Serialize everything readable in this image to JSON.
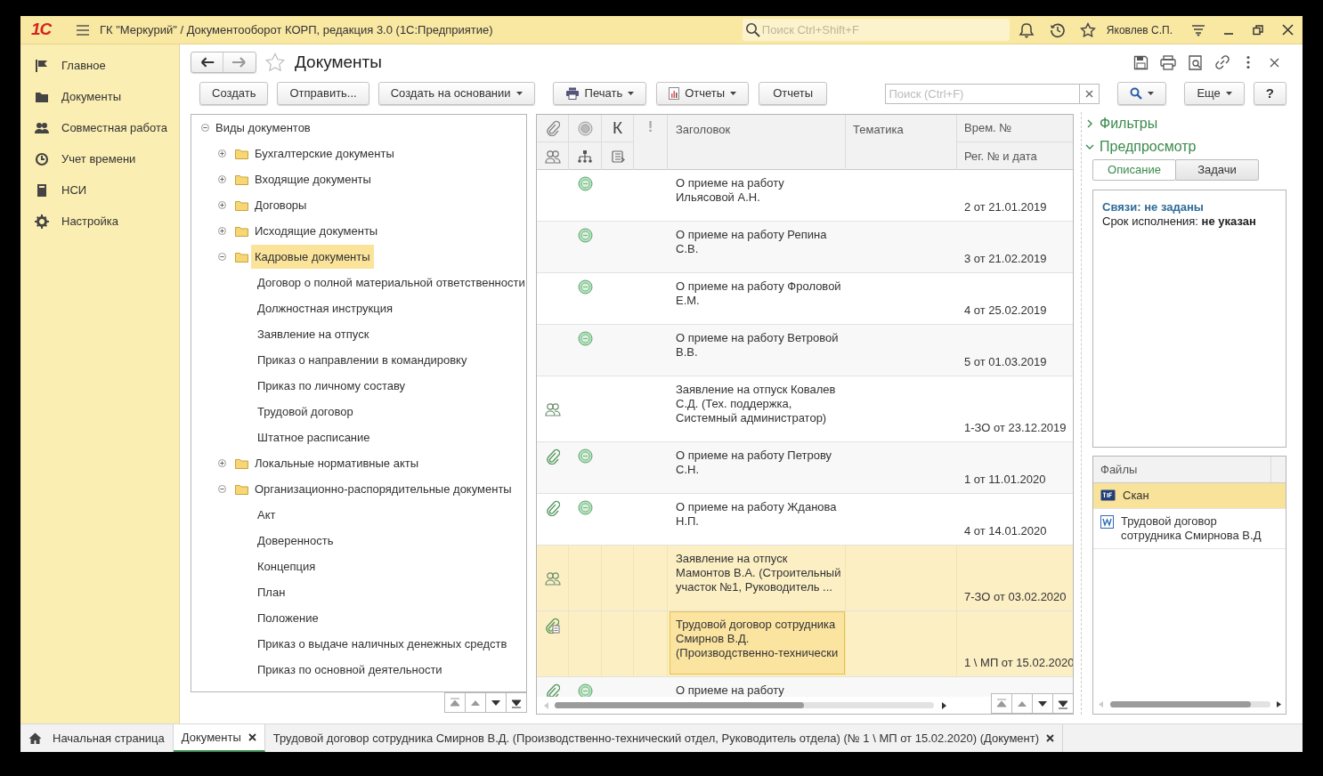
{
  "title_bar": {
    "logo": "1С",
    "title": "ГК \"Меркурий\" / Документооборот КОРП, редакция 3.0  (1С:Предприятие)",
    "search": {
      "placeholder": "Поиск Ctrl+Shift+F"
    },
    "user": "Яковлев С.П."
  },
  "sidebar": {
    "items": [
      {
        "label": "Главное"
      },
      {
        "label": "Документы"
      },
      {
        "label": "Совместная работа"
      },
      {
        "label": "Учет времени"
      },
      {
        "label": "НСИ"
      },
      {
        "label": "Настройка"
      }
    ]
  },
  "form": {
    "title": "Документы",
    "toolbar": [
      {
        "label": "Создать",
        "kind": "plain"
      },
      {
        "label": "Отправить...",
        "kind": "plain"
      },
      {
        "label": "Создать на основании",
        "kind": "dropdown"
      },
      {
        "label": "Печать",
        "kind": "print"
      },
      {
        "label": "Отчеты",
        "kind": "report"
      },
      {
        "label": "Отчеты",
        "kind": "plain"
      }
    ],
    "search": {
      "placeholder": "Поиск (Ctrl+F)"
    },
    "more_button": "Еще",
    "help_button": "?"
  },
  "tree": {
    "items": [
      {
        "label": "Виды документов",
        "kind": "root",
        "expanded": true,
        "selected": false,
        "children": [
          {
            "label": "Бухгалтерские документы",
            "kind": "folder",
            "expanded": false,
            "selected": false
          },
          {
            "label": "Входящие документы",
            "kind": "folder",
            "expanded": false,
            "selected": false
          },
          {
            "label": "Договоры",
            "kind": "folder",
            "expanded": false,
            "selected": false
          },
          {
            "label": "Исходящие документы",
            "kind": "folder",
            "expanded": false,
            "selected": false
          },
          {
            "label": "Кадровые документы",
            "kind": "folder",
            "expanded": true,
            "selected": true,
            "children": [
              {
                "label": "Договор о полной материальной ответственности",
                "kind": "type",
                "selected": false
              },
              {
                "label": "Должностная инструкция",
                "kind": "type",
                "selected": false
              },
              {
                "label": "Заявление на отпуск",
                "kind": "type",
                "selected": false
              },
              {
                "label": "Приказ о направлении в командировку",
                "kind": "type",
                "selected": false
              },
              {
                "label": "Приказ по личному составу",
                "kind": "type",
                "selected": false
              },
              {
                "label": "Трудовой договор",
                "kind": "type",
                "selected": false
              },
              {
                "label": "Штатное расписание",
                "kind": "type",
                "selected": false
              }
            ]
          },
          {
            "label": "Локальные нормативные акты",
            "kind": "folder",
            "expanded": false,
            "selected": false
          },
          {
            "label": "Организационно-распорядительные документы",
            "kind": "folder",
            "expanded": true,
            "selected": false,
            "children": [
              {
                "label": "Акт",
                "kind": "type",
                "selected": false
              },
              {
                "label": "Доверенность",
                "kind": "type",
                "selected": false
              },
              {
                "label": "Концепция",
                "kind": "type",
                "selected": false
              },
              {
                "label": "План",
                "kind": "type",
                "selected": false
              },
              {
                "label": "Положение",
                "kind": "type",
                "selected": false
              },
              {
                "label": "Приказ о выдаче наличных денежных средств",
                "kind": "type",
                "selected": false
              },
              {
                "label": "Приказ по основной деятельности",
                "kind": "type",
                "selected": false
              }
            ]
          }
        ]
      }
    ]
  },
  "table": {
    "header_marks": [
      "К",
      "!"
    ],
    "columns": [
      "Заголовок",
      "Тематика",
      "Врем. №",
      "Рег. № и дата"
    ],
    "rows": [
      {
        "attachment": false,
        "attached_document": false,
        "status": true,
        "participants": false,
        "title": "О приеме на работу Ильясовой А.Н.",
        "reg_number": "2 от 21.01.2019",
        "selected": false,
        "focused": false
      },
      {
        "attachment": false,
        "attached_document": false,
        "status": true,
        "participants": false,
        "title": "О приеме на работу Репина С.В.",
        "reg_number": "3 от 21.02.2019",
        "selected": false,
        "focused": false
      },
      {
        "attachment": false,
        "attached_document": false,
        "status": true,
        "participants": false,
        "title": "О приеме на работу Фроловой Е.М.",
        "reg_number": "4 от 25.02.2019",
        "selected": false,
        "focused": false
      },
      {
        "attachment": false,
        "attached_document": false,
        "status": true,
        "participants": false,
        "title": "О приеме на работу Ветровой В.В.",
        "reg_number": "5 от 01.03.2019",
        "selected": false,
        "focused": false
      },
      {
        "attachment": false,
        "attached_document": false,
        "status": false,
        "participants": true,
        "title": "Заявление на отпуск Ковалев С.Д. (Тех. поддержка, Системный администратор)",
        "reg_number": "1-ЗО от 23.12.2019",
        "selected": false,
        "focused": false
      },
      {
        "attachment": true,
        "attached_document": false,
        "status": true,
        "participants": false,
        "title": "О приеме на работу Петрову С.Н.",
        "reg_number": "1 от 11.01.2020",
        "selected": false,
        "focused": false
      },
      {
        "attachment": true,
        "attached_document": false,
        "status": true,
        "participants": false,
        "title": "О приеме на работу Жданова Н.П.",
        "reg_number": "4 от 14.01.2020",
        "selected": false,
        "focused": false
      },
      {
        "attachment": false,
        "attached_document": false,
        "status": false,
        "participants": true,
        "title": "Заявление на отпуск Мамонтов В.А. (Строительный участок №1, Руководитель ...",
        "reg_number": "7-ЗО от 03.02.2020",
        "selected": true,
        "focused": false
      },
      {
        "attachment": true,
        "attached_document": true,
        "status": false,
        "participants": false,
        "title": "Трудовой договор сотрудника Смирнов В.Д. (Производственно-технически",
        "reg_number": "1 \\ МП от 15.02.2020",
        "selected": true,
        "focused": true
      },
      {
        "attachment": true,
        "attached_document": false,
        "status": true,
        "participants": false,
        "title": "О приеме на работу",
        "selected": false,
        "focused": false
      }
    ]
  },
  "side_panel": {
    "sections": [
      {
        "label": "Фильтры",
        "expanded": false
      },
      {
        "label": "Предпросмотр",
        "expanded": true
      }
    ],
    "tabs": [
      {
        "label": "Описание",
        "selected": true
      },
      {
        "label": "Задачи",
        "selected": false
      }
    ],
    "preview": {
      "links": "Связи: не заданы",
      "deadline": "Срок исполнения: **не указан**"
    },
    "files": {
      "header": "Файлы",
      "rows": [
        {
          "name": "Скан",
          "kind": "tif",
          "selected": true
        },
        {
          "name": "Трудовой договор сотрудника Смирнова В.Д",
          "kind": "word",
          "selected": false
        }
      ]
    }
  },
  "open_tabs": [
    {
      "label": "Начальная страница",
      "kind": "home",
      "selected": false
    },
    {
      "label": "Документы",
      "kind": "closable",
      "selected": true
    },
    {
      "label": "Трудовой договор сотрудника Смирнов В.Д. (Производственно-технический отдел, Руководитель отдела) (№ 1 \\ МП от 15.02.2020) (Документ)",
      "kind": "closable",
      "selected": false
    }
  ]
}
